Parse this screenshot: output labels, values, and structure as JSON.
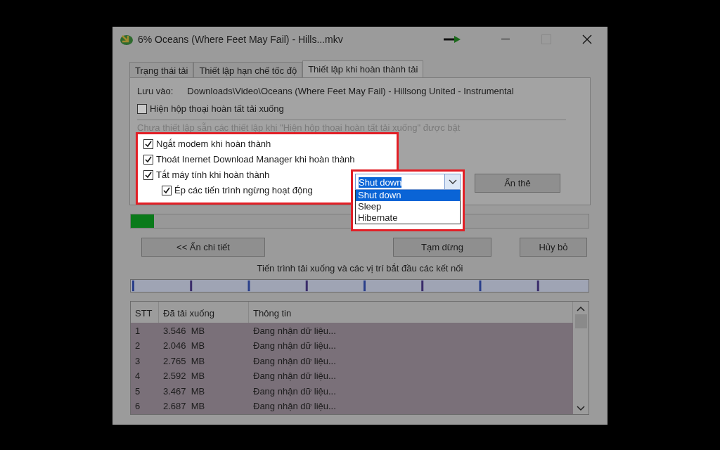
{
  "window": {
    "title": "6% Oceans (Where Feet May Fail) - Hills...mkv",
    "maximize_disabled": true
  },
  "tabs": [
    {
      "label": "Trạng thái tải",
      "selected": false
    },
    {
      "label": "Thiết lập hạn chế tốc độ",
      "selected": false
    },
    {
      "label": "Thiết lập khi hoàn thành tải",
      "selected": true
    }
  ],
  "save_to": {
    "label": "Lưu vào:",
    "path": "Downloads\\Video\\Oceans (Where Feet May Fail) - Hillsong United - Instrumental"
  },
  "show_dialog": {
    "label": "Hiện hộp thoại hoàn tất tải xuống",
    "checked": false
  },
  "note": {
    "text": "Chưa thiết lập sẵn các thiết lập khi \"Hiện hộp thoại hoàn tất tải xuống\" được bật",
    "disabled": true
  },
  "options": [
    {
      "label": "Ngắt modem khi hoàn thành",
      "checked": true
    },
    {
      "label": "Thoát Inernet Download Manager khi hoàn thành",
      "checked": true
    },
    {
      "label": "Tắt máy tính khi hoàn thành",
      "checked": true,
      "children": [
        {
          "label": "Ép các tiến trình ngừng hoạt động",
          "checked": true
        }
      ]
    }
  ],
  "shutdown_select": {
    "value": "Shut down",
    "expanded": true,
    "options": [
      {
        "label": "Shut down",
        "selected": true
      },
      {
        "label": "Sleep",
        "selected": false
      },
      {
        "label": "Hibernate",
        "selected": false
      }
    ]
  },
  "hide_tabs_button": "Ẩn thẻ",
  "progress": {
    "level": 0.05
  },
  "buttons": [
    {
      "label": "<< Ẩn chi tiết"
    },
    {
      "label": "Tạm dừng"
    },
    {
      "label": "Hủy bỏ"
    }
  ],
  "connections_label": "Tiến trình tải xuống và các vị trí bắt đầu các kết nối",
  "table": {
    "columns": [
      "STT",
      "Đã tải xuống",
      "Thông tin"
    ],
    "rows": [
      [
        "1",
        "3.546  MB",
        "Đang nhận dữ liệu..."
      ],
      [
        "2",
        "2.046  MB",
        "Đang nhận dữ liệu..."
      ],
      [
        "3",
        "2.765  MB",
        "Đang nhận dữ liệu..."
      ],
      [
        "4",
        "2.592  MB",
        "Đang nhận dữ liệu..."
      ],
      [
        "5",
        "3.467  MB",
        "Đang nhận dữ liệu..."
      ],
      [
        "6",
        "2.687  MB",
        "Đang nhận dữ liệu..."
      ]
    ]
  }
}
